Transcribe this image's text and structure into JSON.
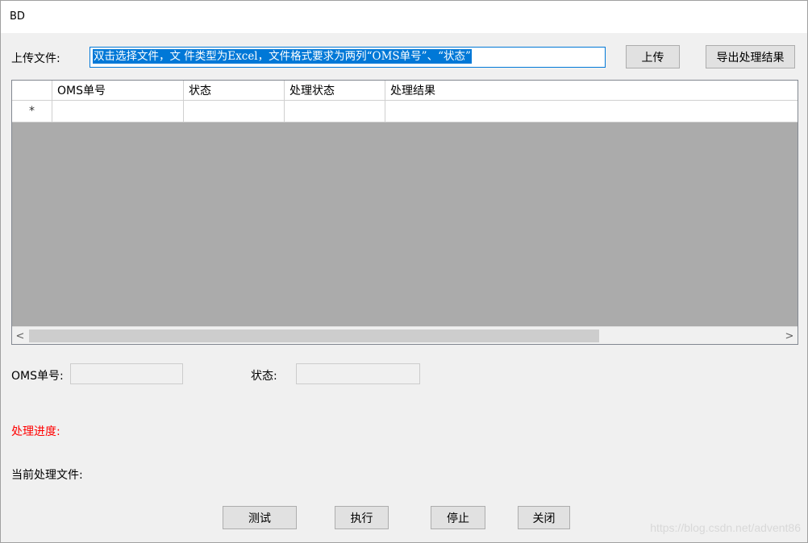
{
  "window": {
    "title": "BD"
  },
  "upload": {
    "label": "上传文件:",
    "input_value": "双击选择文件，文 件类型为Excel，文件格式要求为两列“OMS单号”、“状态”",
    "upload_button": "上传",
    "export_button": "导出处理结果"
  },
  "grid": {
    "columns": [
      "OMS单号",
      "状态",
      "处理状态",
      "处理结果"
    ],
    "new_row_marker": "*",
    "scroll_left": "<",
    "scroll_right": ">"
  },
  "fields": {
    "oms_label": "OMS单号:",
    "status_label": "状态:"
  },
  "progress": {
    "label": "处理进度:",
    "color": "#ff0000"
  },
  "current_file": {
    "label": "当前处理文件:"
  },
  "buttons": {
    "test": "测试",
    "execute": "执行",
    "stop": "停止",
    "close": "关闭"
  },
  "watermark": "https://blog.csdn.net/advent86"
}
